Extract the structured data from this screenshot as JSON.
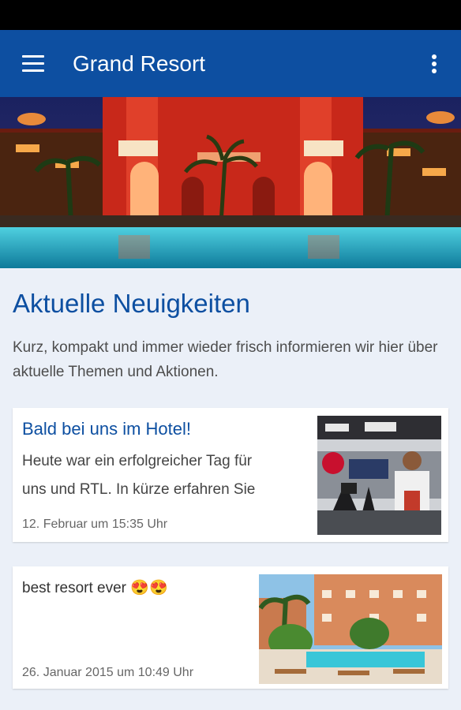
{
  "app_bar": {
    "title": "Grand Resort",
    "menu_icon": "hamburger-menu-icon",
    "overflow_icon": "more-vert-icon",
    "color": "#0d4fa1"
  },
  "hero": {
    "description": "resort-hotel-night-pool-photo"
  },
  "news": {
    "heading": "Aktuelle Neuigkeiten",
    "intro": "Kurz, kompakt und immer wieder frisch informieren wir hier über aktuelle Themen und Aktionen."
  },
  "posts": [
    {
      "title": "Bald bei uns im Hotel!",
      "text_line1": "Heute war ein erfolgreicher Tag für",
      "text_line2": "uns und RTL. In kürze erfahren Sie",
      "date": "12. Februar um 15:35 Uhr",
      "thumb_icon": "tv-studio-photo"
    },
    {
      "text": "best resort ever",
      "emoji": "😍😍",
      "date": "26. Januar 2015 um 10:49 Uhr",
      "thumb_icon": "resort-pool-photo"
    }
  ]
}
